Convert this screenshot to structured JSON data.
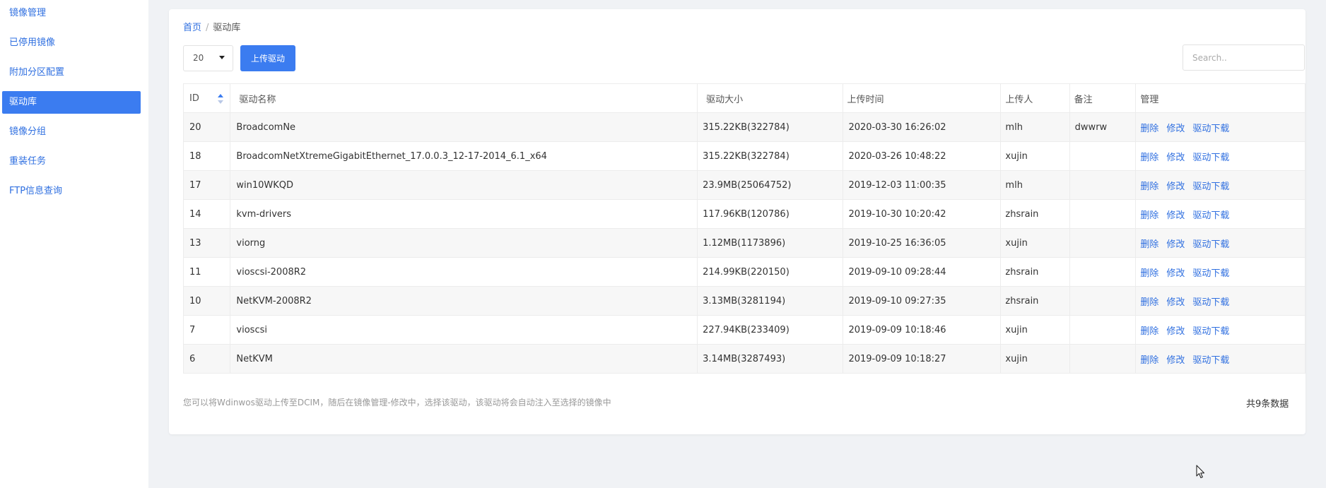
{
  "sidebar": {
    "items": [
      {
        "label": "镜像管理"
      },
      {
        "label": "已停用镜像"
      },
      {
        "label": "附加分区配置"
      },
      {
        "label": "驱动库"
      },
      {
        "label": "镜像分组"
      },
      {
        "label": "重装任务"
      },
      {
        "label": "FTP信息查询"
      }
    ],
    "active_index": 3
  },
  "breadcrumb": {
    "home": "首页",
    "separator": "/",
    "current": "驱动库"
  },
  "toolbar": {
    "page_size_value": "20",
    "upload_label": "上传驱动",
    "search_placeholder": "Search.."
  },
  "table": {
    "headers": {
      "id": "ID",
      "name": "驱动名称",
      "size": "驱动大小",
      "time": "上传时间",
      "uploader": "上传人",
      "remark": "备注",
      "manage": "管理"
    },
    "action_labels": {
      "delete": "删除",
      "edit": "修改",
      "download": "驱动下载"
    },
    "rows": [
      {
        "id": "20",
        "name": "BroadcomNe",
        "size": "315.22KB(322784)",
        "time": "2020-03-30 16:26:02",
        "uploader": "mlh",
        "remark": "dwwrw"
      },
      {
        "id": "18",
        "name": "BroadcomNetXtremeGigabitEthernet_17.0.0.3_12-17-2014_6.1_x64",
        "size": "315.22KB(322784)",
        "time": "2020-03-26 10:48:22",
        "uploader": "xujin",
        "remark": ""
      },
      {
        "id": "17",
        "name": "win10WKQD",
        "size": "23.9MB(25064752)",
        "time": "2019-12-03 11:00:35",
        "uploader": "mlh",
        "remark": ""
      },
      {
        "id": "14",
        "name": "kvm-drivers",
        "size": "117.96KB(120786)",
        "time": "2019-10-30 10:20:42",
        "uploader": "zhsrain",
        "remark": ""
      },
      {
        "id": "13",
        "name": "viorng",
        "size": "1.12MB(1173896)",
        "time": "2019-10-25 16:36:05",
        "uploader": "xujin",
        "remark": ""
      },
      {
        "id": "11",
        "name": "vioscsi-2008R2",
        "size": "214.99KB(220150)",
        "time": "2019-09-10 09:28:44",
        "uploader": "zhsrain",
        "remark": ""
      },
      {
        "id": "10",
        "name": "NetKVM-2008R2",
        "size": "3.13MB(3281194)",
        "time": "2019-09-10 09:27:35",
        "uploader": "zhsrain",
        "remark": ""
      },
      {
        "id": "7",
        "name": "vioscsi",
        "size": "227.94KB(233409)",
        "time": "2019-09-09 10:18:46",
        "uploader": "xujin",
        "remark": ""
      },
      {
        "id": "6",
        "name": "NetKVM",
        "size": "3.14MB(3287493)",
        "time": "2019-09-09 10:18:27",
        "uploader": "xujin",
        "remark": ""
      }
    ]
  },
  "footer": {
    "note": "您可以将Wdinwos驱动上传至DCIM，随后在镜像管理-修改中，选择该驱动，该驱动将会自动注入至选择的镜像中",
    "total": "共9条数据"
  },
  "colors": {
    "accent": "#3b7cf0",
    "link": "#2f6fe0"
  }
}
